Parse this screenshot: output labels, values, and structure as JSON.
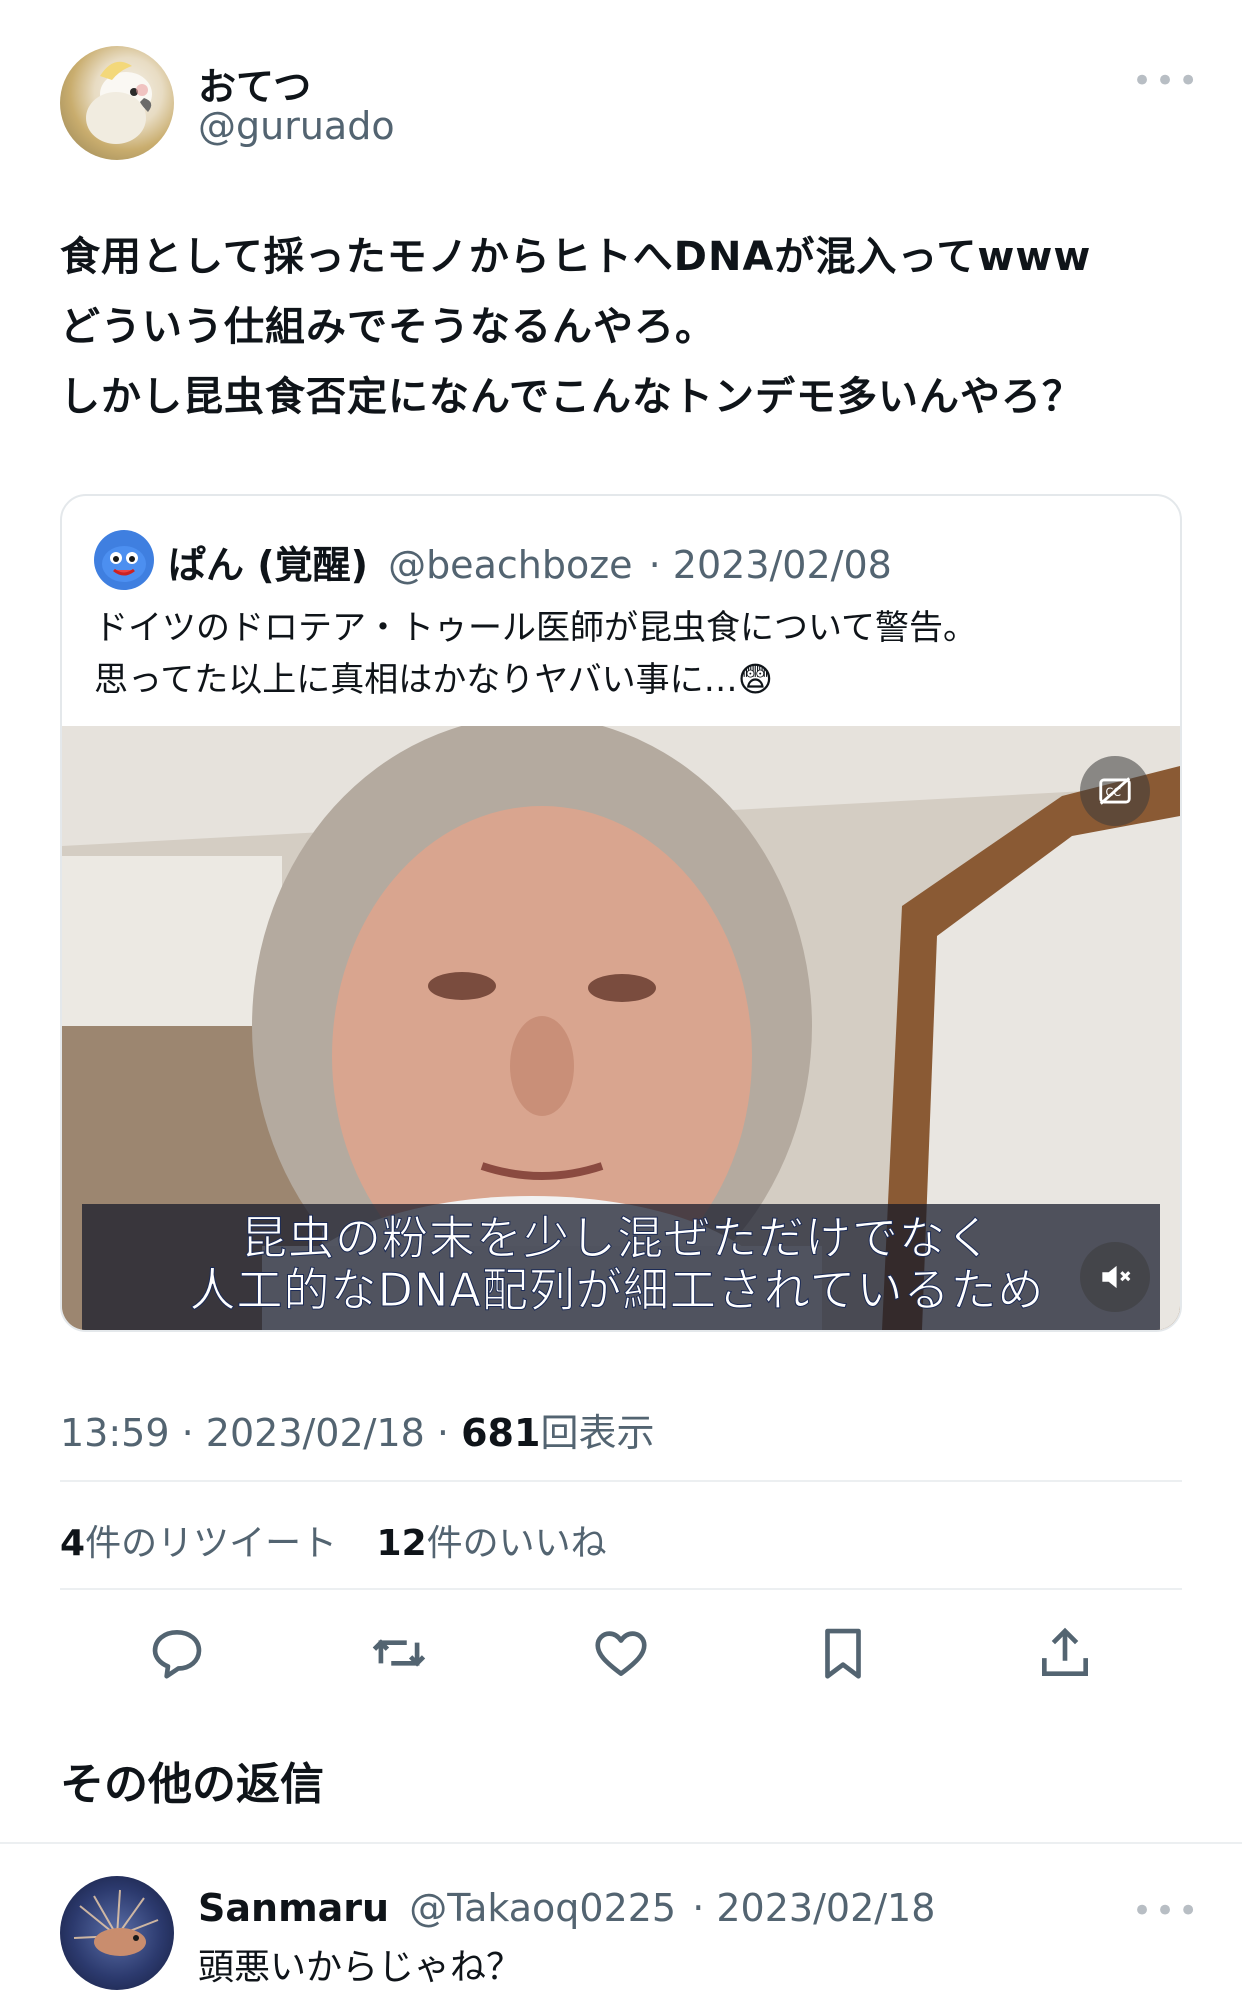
{
  "tweet": {
    "author_name": "おてつ",
    "author_handle": "@guruado",
    "more_label": "•••",
    "text": "食用として採ったモノからヒトへDNAが混入ってwww\nどういう仕組みでそうなるんやろ。\nしかし昆虫食否定になんでこんなトンデモ多いんやろ？",
    "time": "13:59",
    "date": "2023/02/18",
    "separator": "·",
    "views": "681",
    "views_label": "回表示",
    "retweets": "4",
    "retweets_label": "件のリツイート",
    "likes": "12",
    "likes_label": "件のいいね"
  },
  "quote": {
    "name": "ぱん (覚醒)",
    "handle": "@beachboze",
    "date_text": "· 2023/02/08",
    "text": "ドイツのドロテア・トゥール医師が昆虫食について警告。\n思ってた以上に真相はかなりヤバい事に…😨",
    "subtitle": "昆虫の粉末を少し混ぜただけでなく\n人工的なDNA配列が細工されているため"
  },
  "replies_section": {
    "title": "その他の返信"
  },
  "reply": {
    "name": "Sanmaru",
    "handle": "@Takaoq0225",
    "date_text": "· 2023/02/18",
    "text": "頭悪いからじゃね？",
    "more_label": "•••"
  },
  "colors": {
    "text_primary": "#0f1419",
    "text_secondary": "#536471",
    "divider": "#eceff1",
    "icon": "#536471"
  },
  "icons": {
    "reply": "speech-bubble-icon",
    "retweet": "retweet-arrows-icon",
    "like": "heart-icon",
    "bookmark": "bookmark-icon",
    "share": "share-upload-icon",
    "captions": "captions-icon",
    "mute": "speaker-muted-icon"
  }
}
